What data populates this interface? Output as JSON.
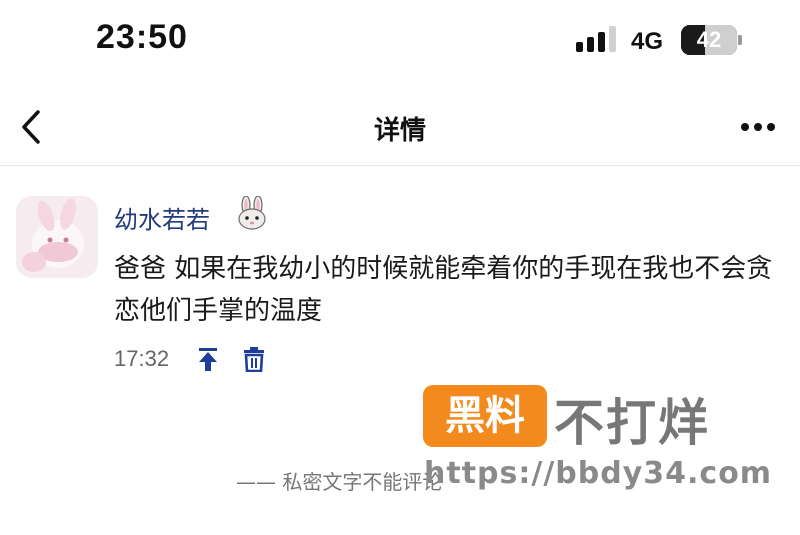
{
  "status_bar": {
    "time": "23:50",
    "network": "4G",
    "battery": "42",
    "battery_level_percent": 42
  },
  "nav": {
    "title": "详情"
  },
  "comment": {
    "username": "幼水若若",
    "username_emoji": "rabbit-face-emoji",
    "text": "爸爸 如果在我幼小的时候就能牵着你的手现在我也不会贪恋他们手掌的温度",
    "time": "17:32",
    "name_color": "#233a7e",
    "action_color": "#1f3e9a"
  },
  "footer": {
    "text": "——  私密文字不能评论"
  },
  "watermark": {
    "brand_box": "黑料",
    "brand_text": "不打烊",
    "url": "https://bbdy34.com",
    "accent": "#f28a1d"
  }
}
